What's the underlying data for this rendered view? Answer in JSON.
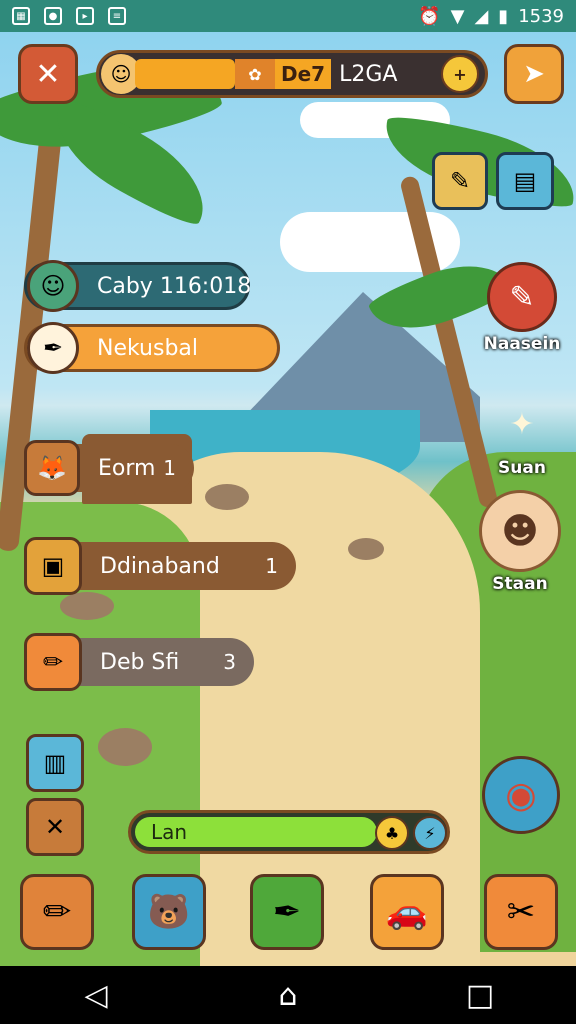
{
  "status_bar": {
    "time": "1539",
    "left_icons": [
      "gallery-icon",
      "notification-icon",
      "play-icon",
      "news-icon"
    ],
    "right_icons": [
      "alarm-icon",
      "wifi-icon",
      "signal-icon",
      "battery-icon"
    ]
  },
  "top_bar": {
    "close_icon": "close-icon",
    "resource_short": "Dе7",
    "resource_value": "L2GA",
    "plus_label": "+",
    "map_icon": "compass-icon"
  },
  "top_right_buttons": [
    {
      "name": "craft-icon"
    },
    {
      "name": "inventory-icon"
    }
  ],
  "left_menu": [
    {
      "name": "player-status",
      "label": "Caby 116:018",
      "count": "",
      "icon": "avatar-icon",
      "style": "teal"
    },
    {
      "name": "quest-item",
      "label": "Nekusbal",
      "count": "",
      "icon": "feather-icon",
      "style": "orange"
    },
    {
      "name": "build-item",
      "label": "Eorm",
      "count": "1",
      "icon": "fox-icon",
      "style": "brown"
    },
    {
      "name": "storage-item",
      "label": "Ddinaband",
      "count": "1",
      "icon": "crate-icon",
      "style": "brown"
    },
    {
      "name": "tool-item",
      "label": "Deb Sfi",
      "count": "3",
      "icon": "brush-icon",
      "style": "gray"
    }
  ],
  "right_menu": [
    {
      "name": "gear-item",
      "label": "Naasein",
      "icon": "wrench-icon"
    },
    {
      "name": "skill-item",
      "label": "Suan",
      "icon": "star-icon"
    },
    {
      "name": "character-item",
      "label": "Staan",
      "icon": "explorer-icon"
    }
  ],
  "left_small_buttons": [
    {
      "name": "stats-icon"
    },
    {
      "name": "tools-icon"
    }
  ],
  "compass_button": "wheel-icon",
  "energy_bar": {
    "label": "Lan",
    "fill_fraction": 0.78
  },
  "dock": [
    {
      "name": "brush-icon",
      "color": "#e0833a"
    },
    {
      "name": "bear-icon",
      "color": "#3ea0c8"
    },
    {
      "name": "feather-icon",
      "color": "#4fa83a"
    },
    {
      "name": "car-icon",
      "color": "#f4a23a"
    },
    {
      "name": "key-icon",
      "color": "#f08a3a"
    }
  ],
  "nav_bar": [
    "back-icon",
    "home-icon",
    "recents-icon"
  ]
}
